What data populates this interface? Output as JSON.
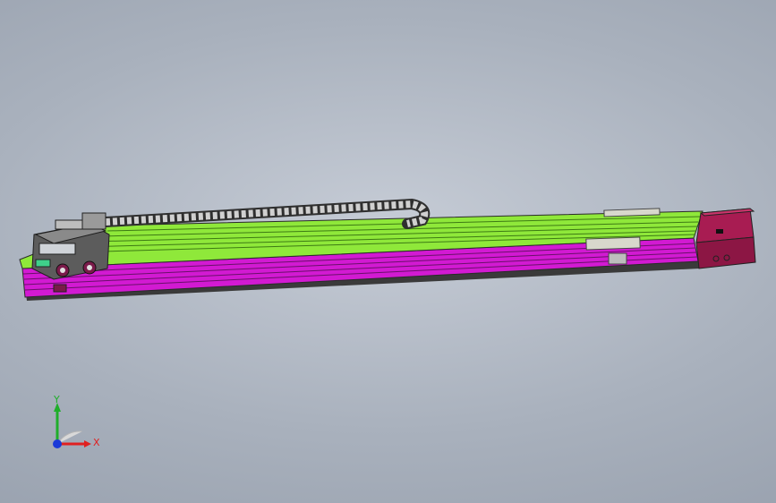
{
  "viewport": {
    "background": "#a9b1bd"
  },
  "model": {
    "colors": {
      "rail_top": "#8fe83a",
      "rail_side": "#d21ad2",
      "end_cap": "#9a1848",
      "carriage": "#6a6a6a",
      "cable_chain": "#c8c8c8"
    }
  },
  "triad": {
    "y_label": "Y",
    "x_label": "X",
    "y_color": "#1fae2a",
    "x_color": "#e02020",
    "z_color": "#1a3ad8"
  }
}
